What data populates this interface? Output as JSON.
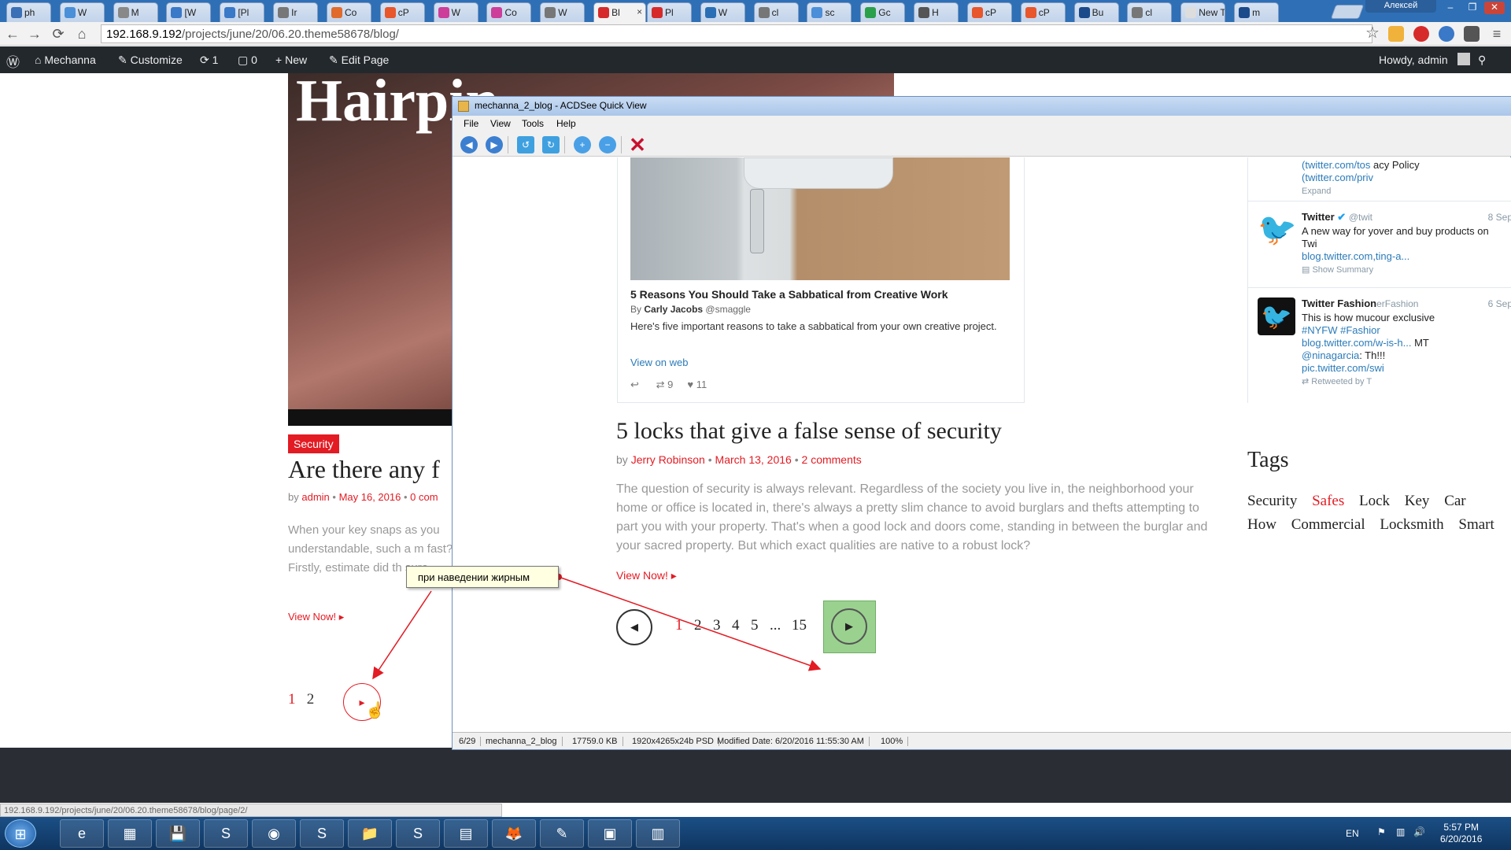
{
  "browser": {
    "tabs": [
      {
        "label": "ph",
        "color": "#3b6fb6"
      },
      {
        "label": "W",
        "color": "#4a8fd8"
      },
      {
        "label": "M",
        "color": "#888888"
      },
      {
        "label": "[W",
        "color": "#3a78c8"
      },
      {
        "label": "[Pl",
        "color": "#3a78c8"
      },
      {
        "label": "Ir",
        "color": "#777777"
      },
      {
        "label": "Co",
        "color": "#e06b2c"
      },
      {
        "label": "cP",
        "color": "#e8562b"
      },
      {
        "label": "W",
        "color": "#cc3e9a"
      },
      {
        "label": "Co",
        "color": "#cc3e9a"
      },
      {
        "label": "W",
        "color": "#777777"
      },
      {
        "label": "Bl",
        "color": "#d62a2a",
        "active": true
      },
      {
        "label": "Pl",
        "color": "#d62a2a"
      },
      {
        "label": "W",
        "color": "#2a6fb5"
      },
      {
        "label": "cl",
        "color": "#777777"
      },
      {
        "label": "sc",
        "color": "#4a8fd8"
      },
      {
        "label": "Gc",
        "color": "#2aa04a"
      },
      {
        "label": "H",
        "color": "#555555"
      },
      {
        "label": "cP",
        "color": "#e8562b"
      },
      {
        "label": "cP",
        "color": "#e8562b"
      },
      {
        "label": "Bu",
        "color": "#1a4a8a"
      },
      {
        "label": "cl",
        "color": "#777777"
      },
      {
        "label": "New T",
        "color": "#dddddd"
      },
      {
        "label": "m",
        "color": "#1a4a8a"
      }
    ],
    "tab_close": "×",
    "window_user": "Алексей",
    "win_minimize": "–",
    "win_restore": "❐",
    "win_close": "✕",
    "back": "←",
    "forward": "→",
    "reload": "⟳",
    "home": "⌂",
    "url_host": "192.168.9.192",
    "url_path": "/projects/june/20/06.20.theme58678/blog/",
    "star": "☆",
    "menu": "≡"
  },
  "wpbar": {
    "logo": "Ⓦ",
    "site": "Mechanna",
    "customize": "Customize",
    "updates": "1",
    "comments": "0",
    "new": "New",
    "edit_page": "Edit Page",
    "howdy": "Howdy, admin",
    "search": "⚲"
  },
  "bgpage": {
    "hero_word": "Hairpin",
    "badge": "Security",
    "title": "Are there any f",
    "meta_by": "by",
    "meta_author": "admin",
    "meta_date": "May 16, 2016",
    "meta_comments": "0 com",
    "excerpt": "When your key snaps as you understandable, such a m fast? Firstly, estimate did th sure…",
    "view_now": "View Now! ▸",
    "pages": [
      "1",
      "2"
    ],
    "next": "▸",
    "cursor": "☝"
  },
  "status_url": "192.168.9.192/projects/june/20/06.20.theme58678/blog/page/2/",
  "acdsee": {
    "title": "mechanna_2_blog - ACDSee Quick View",
    "menu": [
      "File",
      "View",
      "Tools",
      "Help"
    ],
    "status": [
      "6/29",
      "mechanna_2_blog",
      "17759.0 KB",
      "1920x4265x24b PSD",
      "Modified Date: 6/20/2016 11:55:30 AM",
      "100%"
    ]
  },
  "tweet_card": {
    "title": "5 Reasons You Should Take a Sabbatical from Creative Work",
    "by_prefix": "By",
    "author": "Carly Jacobs",
    "handle": "@smaggle",
    "description": "Here's five important reasons to take a sabbatical from your own creative project.",
    "link": "View on web",
    "reply": "↩",
    "retweets": "9",
    "likes": "11"
  },
  "post": {
    "title": "5 locks that give a false sense of security",
    "by": "by",
    "author": "Jerry Robinson",
    "date": "March 13, 2016",
    "comments": "2 comments",
    "excerpt": "The question of security is always relevant. Regardless of the society you live in, the neighborhood your home or office is located in, there's always a pretty slim chance to avoid burglars and thefts attempting to part you with your property. That's when a good lock and doors come, standing in between the burglar and your sacred property. But which exact qualities are native to a robust lock?",
    "view_now": "View Now! ▸",
    "prev": "◀",
    "pages": [
      "1",
      "2",
      "3",
      "4",
      "5",
      "...",
      "15"
    ],
    "next": "▶"
  },
  "twitter": {
    "t0_text1": "(twitter.com/tos",
    "t0_text2": "acy Policy",
    "t0_text3": "(twitter.com/priv",
    "t0_expand": "Expand",
    "t1_name": "Twitter",
    "t1_handle": "@twit",
    "t1_date": "8 Sep",
    "t1_text": "A new way for yover and buy products on Twi",
    "t1_link": "blog.twitter.com,ting-a...",
    "t1_summary": "Show Summary",
    "t2_name": "Twitter Fashion",
    "t2_handle": "erFashion",
    "t2_date": "6 Sep",
    "t2_text1": "This is how mucour exclusive",
    "t2_tags": "#NYFW #Fashior",
    "t2_link1": "blog.twitter.com/w-is-h...",
    "t2_mt": "MT",
    "t2_mention": "@ninagarcia",
    "t2_text2": ": Th!!!",
    "t2_link2": "pic.twitter.com/swi",
    "t2_rt": "Retweeted by T"
  },
  "tags": {
    "heading": "Tags",
    "items": [
      "Security",
      "Safes",
      "Lock",
      "Key",
      "Car",
      "How",
      "Commercial",
      "Locksmith",
      "Smart"
    ]
  },
  "callout": "при наведении жирным",
  "taskbar": {
    "start": "⊞",
    "apps": [
      "e",
      "▦",
      "💾",
      "S",
      "◉",
      "S",
      "📁",
      "S",
      "▤",
      "🦊",
      "✎",
      "▣",
      "▥"
    ],
    "lang": "EN",
    "time": "5:57 PM",
    "date": "6/20/2016"
  },
  "colors": {
    "accent": "#e31b23",
    "twitter": "#2b7bb9",
    "wpbar": "#23282d"
  }
}
